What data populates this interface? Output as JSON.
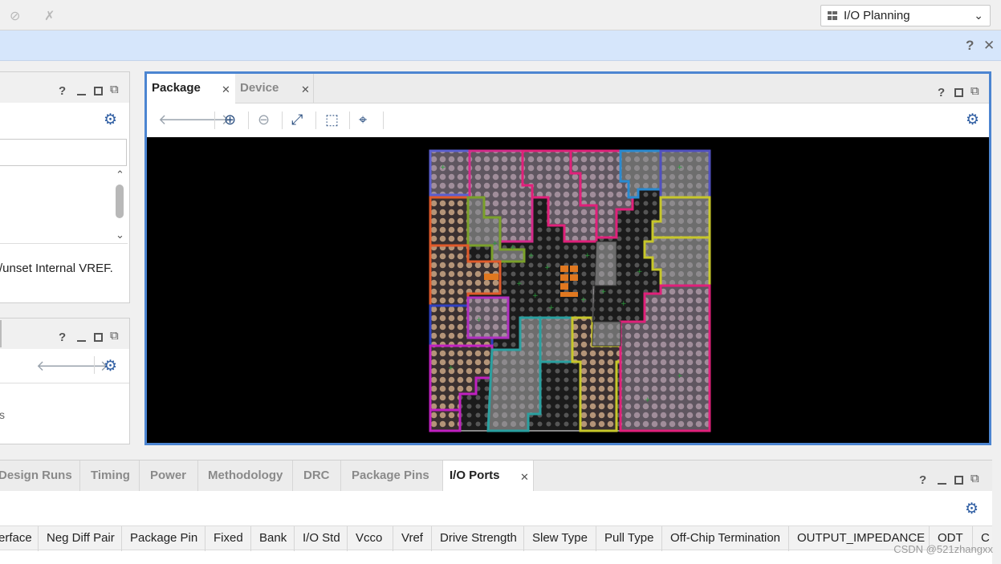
{
  "toolbar": {
    "layout_select_value": "I/O Planning",
    "icons": [
      "unconfigured-icon-disabled",
      "disconnect-icon-disabled"
    ]
  },
  "infobar": {
    "help": "?",
    "close": "✕"
  },
  "left_panel_top": {
    "help": "?",
    "status_text": "/unset Internal VREF."
  },
  "left_panel_bottom": {
    "help": "?",
    "status_text": "s"
  },
  "package_window": {
    "tabs": [
      {
        "label": "Package",
        "active": true
      },
      {
        "label": "Device",
        "active": false
      }
    ],
    "help": "?",
    "tools": [
      "back-icon",
      "forward-icon",
      "zoom-in-icon",
      "zoom-out-icon",
      "zoom-fit-icon",
      "zoom-area-icon",
      "autofit-selection-icon"
    ]
  },
  "bottom_panel": {
    "tabs": [
      "Design Runs",
      "Timing",
      "Power",
      "Methodology",
      "DRC",
      "Package Pins",
      "I/O Ports"
    ],
    "active_tab": "I/O Ports",
    "help": "?",
    "columns": [
      "erface",
      "Neg Diff Pair",
      "Package Pin",
      "Fixed",
      "Bank",
      "I/O Std",
      "Vcco",
      "Vref",
      "Drive Strength",
      "Slew Type",
      "Pull Type",
      "Off-Chip Termination",
      "OUTPUT_IMPEDANCE",
      "ODT",
      "C"
    ]
  },
  "watermark": "CSDN @521zhangxx",
  "colors": {
    "accent_border": "#4c85d1",
    "info_bar": "#d6e6fb",
    "canvas_bg": "#000000",
    "gear_blue": "#2f5ea3"
  }
}
